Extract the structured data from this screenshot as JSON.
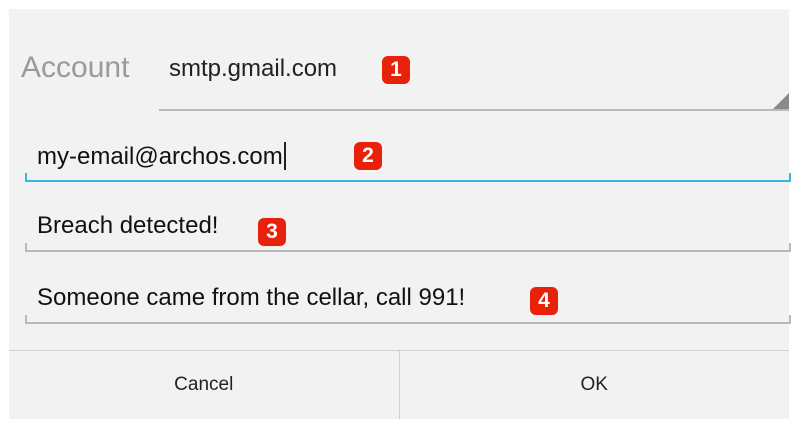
{
  "account": {
    "label": "Account",
    "selected": "smtp.gmail.com",
    "badge": "1"
  },
  "fields": {
    "recipient": {
      "value": "my-email@archos.com",
      "badge": "2"
    },
    "subject": {
      "value": "Breach detected!",
      "badge": "3"
    },
    "message": {
      "value": "Someone came from the cellar, call 991!",
      "badge": "4"
    }
  },
  "buttons": {
    "cancel": "Cancel",
    "ok": "OK"
  },
  "colors": {
    "badge": "#e8210b",
    "focus_underline": "#33b5e5"
  }
}
